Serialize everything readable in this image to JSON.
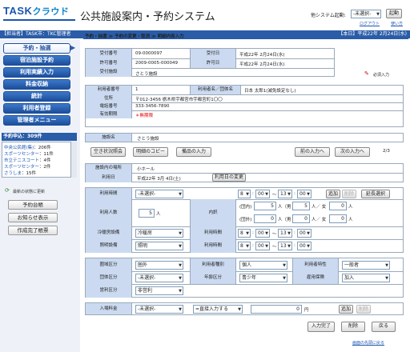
{
  "header": {
    "logo_main": "TASK",
    "logo_sub": "クラウド",
    "app_title": "公共施設案内・予約システム",
    "system_start_label": "他システム起動:",
    "system_start_select": "-未選択-",
    "start_button": "起動",
    "logout": "ログアウト",
    "help": "使い方"
  },
  "topbar": {
    "left": "【担当者】TASK市：TKC管理者",
    "right": "【本日】平成22年 2月24日(水)"
  },
  "sidebar": {
    "nav": [
      {
        "label": "予約・抽選",
        "active": true
      },
      {
        "label": "宿泊施設予約",
        "active": false
      },
      {
        "label": "利用実績入力",
        "active": false
      },
      {
        "label": "料金収納",
        "active": false
      },
      {
        "label": "統計",
        "active": false
      },
      {
        "label": "利用者登録",
        "active": false
      },
      {
        "label": "管理者メニュー",
        "active": false
      }
    ],
    "reservation_header": "予約申込：309件",
    "reservations": [
      {
        "name": "中央公民館(集)",
        "count": "：206件"
      },
      {
        "name": "スポーツセンター",
        "count": "：11件"
      },
      {
        "name": "市立テニスコート",
        "count": "：4件"
      },
      {
        "name": "スポーツセンター",
        "count": "：2件"
      },
      {
        "name": "さうしま",
        "count": "：15件"
      }
    ],
    "refresh_label": "最新の状態に更新",
    "buttons": [
      "予約台帳",
      "お知らせ表示",
      "作成完了帳票"
    ]
  },
  "breadcrumb": "予約・抽選 ≫ 予約の変更・取消 ≫ 明細内容入力",
  "receipt": {
    "accept_no_label": "受付番号",
    "accept_no": "09-0000097",
    "accept_date_label": "受付日",
    "accept_date": "平成22年 2月24日(水)",
    "permit_no_label": "許可番号",
    "permit_no": "2009-0005-000049",
    "permit_date_label": "許可日",
    "permit_date": "平成22年 2月24日(水)",
    "accept_facility_label": "受付施設",
    "accept_facility": "さとう施設",
    "required_note": "必須入力"
  },
  "user": {
    "user_no_label": "利用者番号",
    "user_no": "1",
    "user_name_label": "利用者名／団体名",
    "user_name": "日本 太郎1(減免設定なし)",
    "address_label": "住所",
    "address": "〒012-3456 栃木県宇都宮市宇都宮町1〇〇",
    "phone_label": "電話番号",
    "phone": "333-3456-7890",
    "expiry_label": "有効期限",
    "expiry": "＊無期限"
  },
  "facility": {
    "label": "施設名",
    "value": "さとう施設"
  },
  "actions": {
    "availability": "空き状況照会",
    "copy": "明細のコピー",
    "equipment": "備品の入力",
    "prev": "前の入力へ",
    "next": "次の入力へ",
    "page": "2/3"
  },
  "venue": {
    "place_label": "施設内の場所",
    "place": "小ホール",
    "date_label": "利用日",
    "date": "平成22年 3月 4日(土)",
    "change_date_button": "利用日の変更"
  },
  "usage": {
    "time_label": "利用時間",
    "time_select": "-未選択-",
    "from_h": "8",
    "from_m": "00",
    "to_h": "13",
    "to_m": "00",
    "add": "追加",
    "delete": "削除",
    "extend": "延長選択",
    "people_label": "利用人数",
    "people": "5",
    "people_unit": "人",
    "breakdown_label": "内訳",
    "adult_label": "(団内)",
    "adult": "5",
    "male1": "5",
    "female1": "0",
    "out_label": "(団外)",
    "out": "0",
    "male2": "0",
    "female2": "0",
    "unit_person": "人",
    "male_label": "（男",
    "female_label": "人／ 女",
    "heating_label": "冷暖房設備",
    "heating": "冷暖房",
    "heating_time_label": "利用時間",
    "heating_from_h": "8",
    "heating_from_m": "00",
    "heating_to_h": "13",
    "heating_to_m": "00",
    "lighting_label": "照明設備",
    "lighting": "照明",
    "lighting_time_label": "利用時間",
    "lighting_from_h": "8",
    "lighting_from_m": "00",
    "lighting_to_h": "13",
    "lighting_to_m": "00"
  },
  "classification": {
    "area_label": "圏域区分",
    "area": "圏外",
    "type_label": "利用者種別",
    "type": "個人",
    "attr_label": "利用者特性",
    "attr": "一般者",
    "group_label": "団体区分",
    "group": "-未選択-",
    "age_label": "年齢区分",
    "age": "青少年",
    "insurance_label": "雇用保険",
    "insurance": "加入",
    "purpose_label": "営利区分",
    "purpose": "非営利"
  },
  "fee": {
    "label": "入場料金",
    "select": "-未選択-",
    "method": "=直接入力する",
    "amount": "0",
    "unit": "円",
    "add": "追加",
    "delete": "削除"
  },
  "footer": {
    "complete": "入力完了",
    "delete": "削除",
    "back": "戻る",
    "top_link": "画面の先頭に戻る"
  }
}
